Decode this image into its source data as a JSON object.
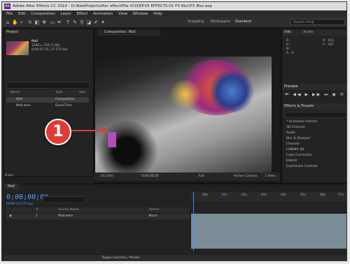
{
  "window": {
    "title": "Adobe After Effects CC 2014 - D:\\NewProject\\after effect\\File VCD\\EP.05 EFFECTS-01 FX Blur\\FX Blur.aep",
    "app_icon": "Ae"
  },
  "menu": [
    "File",
    "Edit",
    "Composition",
    "Layer",
    "Effect",
    "Animation",
    "View",
    "Window",
    "Help"
  ],
  "toolbar": {
    "tools": [
      "home-icon",
      "hand-icon",
      "zoom-icon",
      "rotate-icon",
      "camera-icon",
      "pan-icon",
      "mask-icon",
      "pen-icon",
      "type-icon",
      "brush-icon",
      "clone-icon",
      "eraser-icon",
      "roto-icon",
      "puppet-icon"
    ],
    "snapping": "Snapping",
    "workspace_label": "Workspace:",
    "workspace_value": "Standard",
    "search_help_placeholder": "Search Help"
  },
  "project_panel": {
    "tab": "Project",
    "item_name": "Mall",
    "item_info": [
      "1280 x 720 (1.00)",
      "0;00;07;15, 27.275 fps"
    ],
    "columns": [
      "Name",
      "Type",
      "Size"
    ],
    "rows": [
      {
        "name": "Mall",
        "type": "Composition"
      },
      {
        "name": "Mall.wmv",
        "type": "QuickTime"
      }
    ],
    "footer": "8 bpc"
  },
  "composition_panel": {
    "tab": "Composition: Mall",
    "footer": {
      "zoom": "(41.6%)",
      "timecode": "0;00;00;00",
      "resolution": "Full",
      "view": "Active Camera",
      "views": "1 View"
    }
  },
  "info_panel": {
    "tabs": [
      "Info",
      "Audio"
    ],
    "rgb_labels": [
      "R :",
      "G :",
      "B :",
      "A : 0"
    ],
    "xy": [
      "X : 615",
      "Y : 787"
    ]
  },
  "preview_panel": {
    "tab": "Preview",
    "controls": "⏮ ◀◀ ▶ ▶▶ ⏭ ◉ ⟲"
  },
  "effects_panel": {
    "tab": "Effects & Presets",
    "items": [
      "* Animation Presets",
      "3D Channel",
      "Audio",
      "Blur & Sharpen",
      "Channel",
      "CINEMA 4D",
      "Color Correction",
      "Distort",
      "Expression Controls"
    ]
  },
  "timeline": {
    "tab": "Mall",
    "timecode": "0;00;00;00",
    "fps": "00000 (27.275 fps)",
    "columns": [
      "#",
      "Source Name",
      "Parent"
    ],
    "layer": {
      "index": "1",
      "name": "Mall.wmv",
      "parent": "None"
    },
    "ruler": [
      "00s",
      "01s",
      "02s",
      "03s",
      "04s",
      "05s",
      "06s",
      "07s"
    ],
    "toggle_label": "Toggle Switches / Modes"
  },
  "callout": {
    "label": "1"
  },
  "colors": {
    "callout": "#e23b36",
    "timecode": "#4aa3ff",
    "track": "#7a8d96"
  }
}
